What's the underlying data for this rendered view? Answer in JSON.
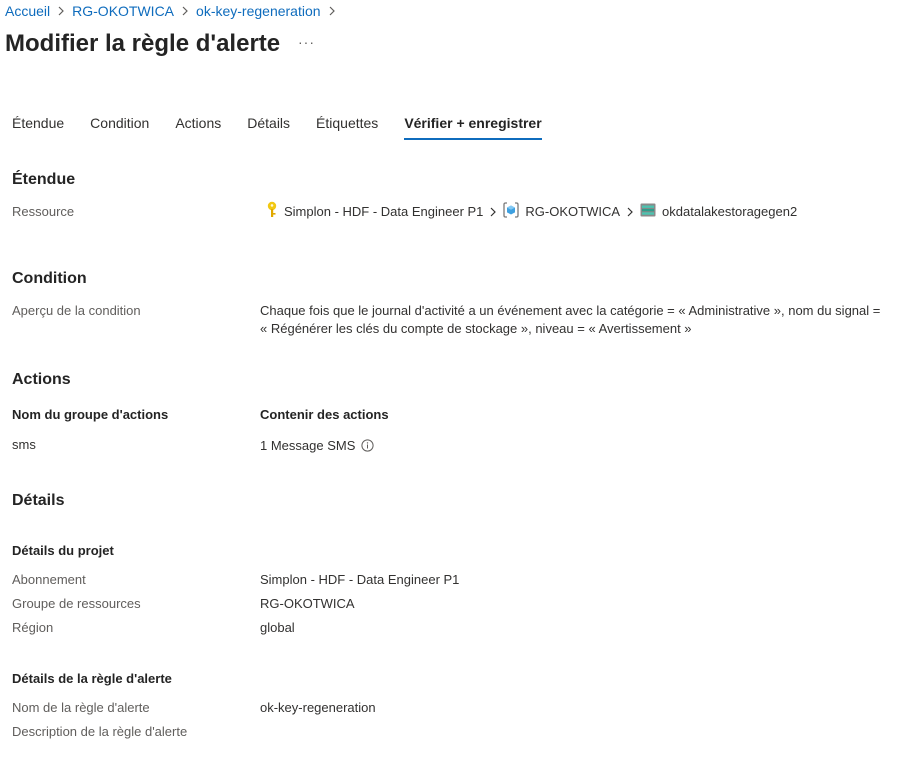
{
  "breadcrumb": {
    "items": [
      "Accueil",
      "RG-OKOTWICA",
      "ok-key-regeneration"
    ]
  },
  "page": {
    "title": "Modifier la règle d'alerte",
    "more_label": "···"
  },
  "tabs": [
    {
      "label": "Étendue",
      "active": false
    },
    {
      "label": "Condition",
      "active": false
    },
    {
      "label": "Actions",
      "active": false
    },
    {
      "label": "Détails",
      "active": false
    },
    {
      "label": "Étiquettes",
      "active": false
    },
    {
      "label": "Vérifier + enregistrer",
      "active": true
    }
  ],
  "scope": {
    "title": "Étendue",
    "resource_label": "Ressource",
    "path": [
      {
        "icon": "key-icon",
        "text": "Simplon - HDF - Data Engineer P1"
      },
      {
        "icon": "resource-group-icon",
        "text": "RG-OKOTWICA"
      },
      {
        "icon": "storage-account-icon",
        "text": "okdatalakestoragegen2"
      }
    ]
  },
  "condition": {
    "title": "Condition",
    "preview_label": "Aperçu de la condition",
    "line1": "Chaque fois que le journal d'activité a un événement avec la catégorie = « Administrative », nom du signal =",
    "line2": "« Régénérer les clés du compte de stockage », niveau = « Avertissement »"
  },
  "actions": {
    "title": "Actions",
    "col_group": "Nom du groupe d'actions",
    "col_contains": "Contenir des actions",
    "rows": [
      {
        "group": "sms",
        "contains": "1 Message SMS"
      }
    ]
  },
  "details": {
    "title": "Détails",
    "project_title": "Détails du projet",
    "subscription_label": "Abonnement",
    "subscription_value": "Simplon - HDF - Data Engineer P1",
    "resource_group_label": "Groupe de ressources",
    "resource_group_value": "RG-OKOTWICA",
    "region_label": "Région",
    "region_value": "global",
    "rule_title": "Détails de la règle d'alerte",
    "rule_name_label": "Nom de la règle d'alerte",
    "rule_name_value": "ok-key-regeneration",
    "rule_desc_label": "Description de la règle d'alerte",
    "rule_desc_value": ""
  },
  "colors": {
    "accent": "#0f6cbd",
    "key": "#f2c811",
    "resource_group": "#3ea0e0",
    "storage": "#2e9c8a"
  }
}
